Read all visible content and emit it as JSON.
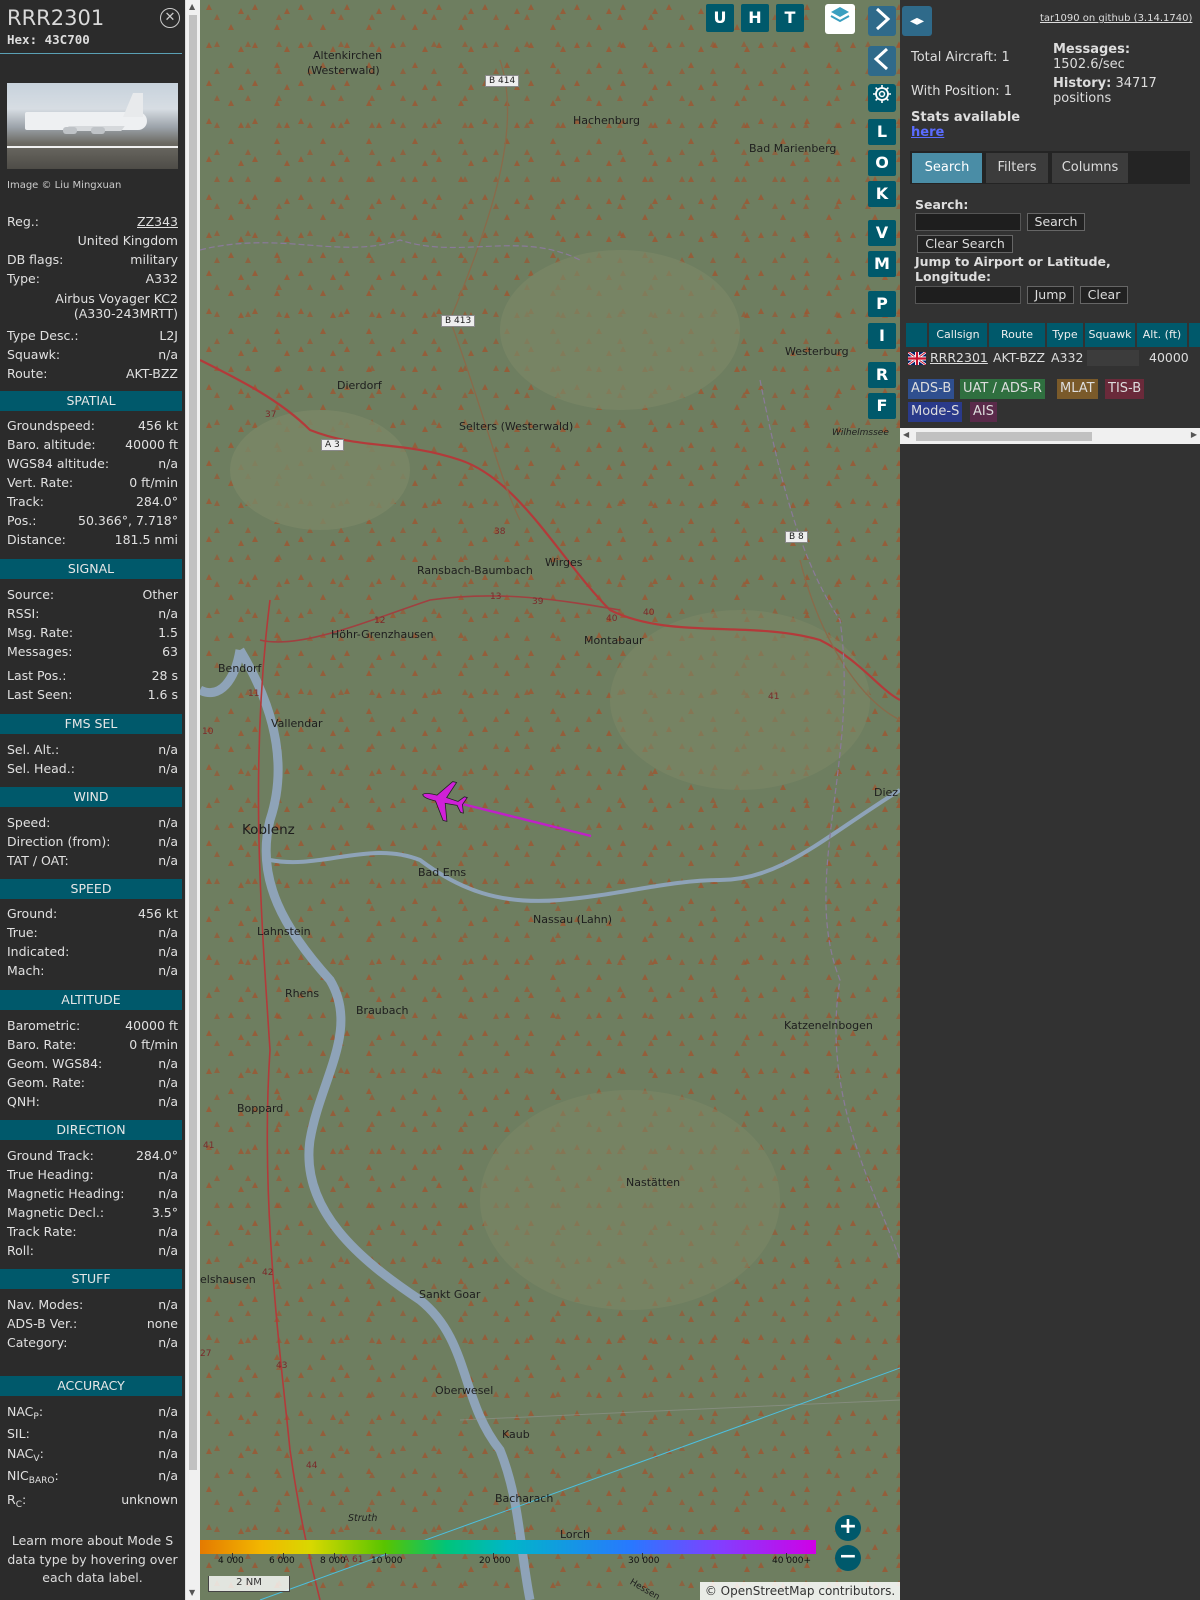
{
  "info": {
    "callsign": "RRR2301",
    "hex": "Hex: 43C700",
    "image_credit": "Image © Liu Mingxuan",
    "top_rows": [
      {
        "label": "Reg.:",
        "value": "ZZ343"
      },
      {
        "label": "",
        "value": "United Kingdom"
      },
      {
        "label": "DB flags:",
        "value": "military"
      },
      {
        "label": "Type:",
        "value": "A332"
      }
    ],
    "type_full_1": "Airbus Voyager KC2",
    "type_full_2": "(A330-243MRTT)",
    "top_rows2": [
      {
        "label": "Type Desc.:",
        "value": "L2J"
      },
      {
        "label": "Squawk:",
        "value": "n/a"
      },
      {
        "label": "Route:",
        "value": "AKT-BZZ"
      }
    ],
    "sections": {
      "spatial": "SPATIAL",
      "signal": "SIGNAL",
      "fms": "FMS SEL",
      "wind": "WIND",
      "speed": "SPEED",
      "altitude": "ALTITUDE",
      "direction": "DIRECTION",
      "stuff": "STUFF",
      "accuracy": "ACCURACY"
    },
    "spatial": [
      {
        "label": "Groundspeed:",
        "value": "456 kt"
      },
      {
        "label": "Baro. altitude:",
        "value": "40000 ft"
      },
      {
        "label": "WGS84 altitude:",
        "value": "n/a"
      },
      {
        "label": "Vert. Rate:",
        "value": "0 ft/min"
      },
      {
        "label": "Track:",
        "value": "284.0°"
      },
      {
        "label": "Pos.:",
        "value": "50.366°, 7.718°"
      },
      {
        "label": "Distance:",
        "value": "181.5 nmi"
      }
    ],
    "signal": [
      {
        "label": "Source:",
        "value": "Other"
      },
      {
        "label": "RSSI:",
        "value": "n/a"
      },
      {
        "label": "Msg. Rate:",
        "value": "1.5"
      },
      {
        "label": "Messages:",
        "value": "63"
      },
      {
        "label": "Last Pos.:",
        "value": "28 s"
      },
      {
        "label": "Last Seen:",
        "value": "1.6 s"
      }
    ],
    "fms": [
      {
        "label": "Sel. Alt.:",
        "value": "n/a"
      },
      {
        "label": "Sel. Head.:",
        "value": "n/a"
      }
    ],
    "wind": [
      {
        "label": "Speed:",
        "value": "n/a"
      },
      {
        "label": "Direction (from):",
        "value": "n/a"
      },
      {
        "label": "TAT / OAT:",
        "value": "n/a"
      }
    ],
    "speed": [
      {
        "label": "Ground:",
        "value": "456 kt"
      },
      {
        "label": "True:",
        "value": "n/a"
      },
      {
        "label": "Indicated:",
        "value": "n/a"
      },
      {
        "label": "Mach:",
        "value": "n/a"
      }
    ],
    "altitude": [
      {
        "label": "Barometric:",
        "value": "40000 ft"
      },
      {
        "label": "Baro. Rate:",
        "value": "0 ft/min"
      },
      {
        "label": "Geom. WGS84:",
        "value": "n/a"
      },
      {
        "label": "Geom. Rate:",
        "value": "n/a"
      },
      {
        "label": "QNH:",
        "value": "n/a"
      }
    ],
    "direction": [
      {
        "label": "Ground Track:",
        "value": "284.0°"
      },
      {
        "label": "True Heading:",
        "value": "n/a"
      },
      {
        "label": "Magnetic Heading:",
        "value": "n/a"
      },
      {
        "label": "Magnetic Decl.:",
        "value": "3.5°"
      },
      {
        "label": "Track Rate:",
        "value": "n/a"
      },
      {
        "label": "Roll:",
        "value": "n/a"
      }
    ],
    "stuff": [
      {
        "label": "Nav. Modes:",
        "value": "n/a"
      },
      {
        "label": "ADS-B Ver.:",
        "value": "none"
      },
      {
        "label": "Category:",
        "value": "n/a"
      }
    ],
    "accuracy": {
      "nacp": {
        "main": "NAC",
        "sub": "P",
        "value": "n/a"
      },
      "sil": {
        "label": "SIL:",
        "value": "n/a"
      },
      "nacv": {
        "main": "NAC",
        "sub": "V",
        "value": "n/a"
      },
      "nicbaro": {
        "main": "NIC",
        "sub": "BARO",
        "value": "n/a"
      },
      "rc": {
        "main": "R",
        "sub": "C",
        "value": "unknown"
      }
    },
    "learn_more": [
      "Learn more about Mode S",
      "data type by hovering over",
      "each data label."
    ]
  },
  "map": {
    "buttons": {
      "u": "U",
      "h": "H",
      "t": "T",
      "l": "L",
      "o": "O",
      "k": "K",
      "v": "V",
      "m": "M",
      "p": "P",
      "i": "I",
      "r": "R",
      "f": "F"
    },
    "towns": {
      "altenkirchen_1": "Altenkirchen",
      "altenkirchen_2": "(Westerwald)",
      "hachenburg": "Hachenburg",
      "bad_marienberg": "Bad Marienberg",
      "westerburg": "Westerburg",
      "wilhelmssee": "Wilhelmssee",
      "dierdorf": "Dierdorf",
      "selters": "Selters (Westerwald)",
      "ransbach": "Ransbach-Baumbach",
      "wirges": "Wirges",
      "hohr": "Höhr-Grenzhausen",
      "montabaur": "Montabaur",
      "bendorf": "Bendorf",
      "vallendar": "Vallendar",
      "koblenz": "Koblenz",
      "bad_ems": "Bad Ems",
      "diez": "Diez",
      "nassau": "Nassau (Lahn)",
      "lahnstein": "Lahnstein",
      "rhens": "Rhens",
      "braubach": "Braubach",
      "katzenelnbogen": "Katzenelnbogen",
      "boppard": "Boppard",
      "nastatten": "Nastätten",
      "elshausen": "elshausen",
      "sankt_goar": "Sankt Goar",
      "oberwesel": "Oberwesel",
      "kaub": "Kaub",
      "struth": "Struth",
      "bacharach": "Bacharach",
      "lorch": "Lorch",
      "hessen": "Hessen"
    },
    "roads": {
      "b414": "B 414",
      "b413": "B 413",
      "a3": "A 3",
      "b8": "B 8",
      "r37": "37",
      "r38": "38",
      "r13": "13",
      "r39": "39",
      "r12": "12",
      "r40a": "40",
      "r40b": "40",
      "r41": "41",
      "r11": "11",
      "r10": "10",
      "r41b": "41",
      "r42": "42",
      "r43": "43",
      "r44": "44",
      "r27": "27",
      "a61": "A 61"
    },
    "color_scale": [
      "4 000",
      "6 000",
      "8 000",
      "10 000",
      "20 000",
      "30 000",
      "40 000+"
    ],
    "scale_bar": "2 NM",
    "attribution_prefix": "©",
    "attribution_link": "OpenStreetMap",
    "attribution_suffix": "contributors.",
    "zoom_in": "+",
    "zoom_out": "−"
  },
  "right": {
    "github_link": "tar1090 on github (3.14.1740)",
    "total_aircraft": "Total Aircraft: 1",
    "with_position": "With Position: 1",
    "stats_available": "Stats available",
    "here": "here",
    "messages_label": "Messages:",
    "messages_value": "1502.6/sec",
    "history_label": "History:",
    "history_value_1": "34717",
    "history_value_2": "positions",
    "tabs": [
      "Search",
      "Filters",
      "Columns"
    ],
    "search_label": "Search:",
    "search_button": "Search",
    "clear_search_button": "Clear Search",
    "jump_label_1": "Jump to Airport or Latitude,",
    "jump_label_2": "Longitude:",
    "jump_button": "Jump",
    "clear_button": "Clear",
    "table_headers": [
      "Callsign",
      "Route",
      "Type",
      "Squawk",
      "Alt. (ft)"
    ],
    "table_row": {
      "callsign": "RRR2301",
      "route": "AKT-BZZ",
      "type": "A332",
      "squawk": "",
      "alt": "40000"
    },
    "sources": [
      "ADS-B",
      "UAT / ADS-R",
      "MLAT",
      "TIS-B",
      "Mode-S",
      "AIS"
    ],
    "colors": {
      "accent": "#00596b",
      "track": "#c020c8"
    }
  }
}
